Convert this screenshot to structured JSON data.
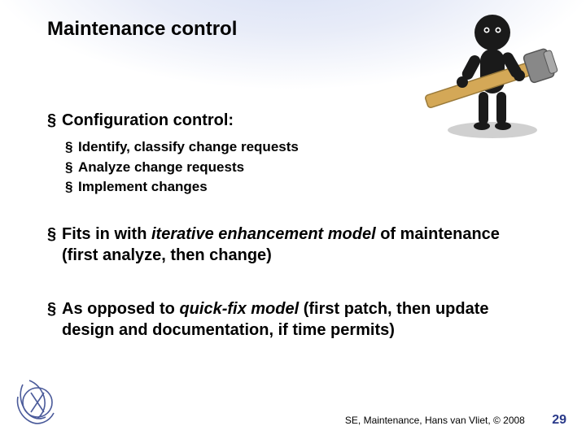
{
  "slide": {
    "title": "Maintenance control",
    "bullets": [
      {
        "text": "Configuration control:",
        "sub": [
          "Identify, classify change requests",
          "Analyze change requests",
          "Implement changes"
        ]
      },
      {
        "text_parts": [
          "Fits in with ",
          "iterative enhancement model",
          " of maintenance (first analyze, then change)"
        ],
        "em_index": 1
      },
      {
        "text_parts": [
          "As opposed to ",
          "quick-fix model",
          " (first patch, then update design and documentation, if time permits)"
        ],
        "em_index": 1
      }
    ]
  },
  "footer": {
    "reference": "SE, Maintenance, Hans van Vliet, © 2008",
    "page": "29"
  }
}
